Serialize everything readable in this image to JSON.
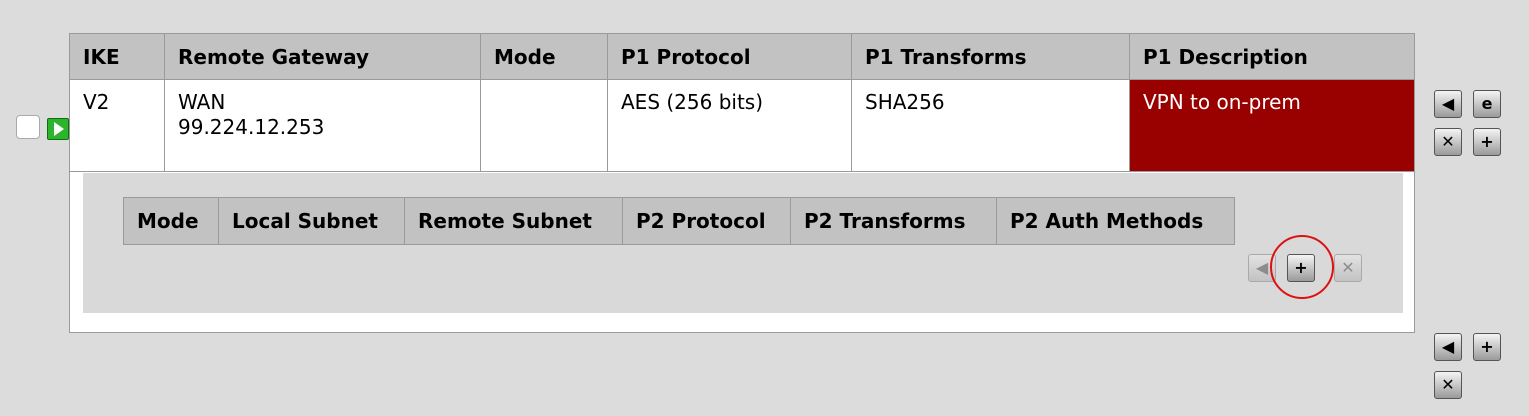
{
  "phase1": {
    "headers": [
      "IKE",
      "Remote Gateway",
      "Mode",
      "P1 Protocol",
      "P1 Transforms",
      "P1 Description"
    ],
    "row": {
      "ike": "V2",
      "gateway_interface": "WAN",
      "gateway_ip": "99.224.12.253",
      "mode": "",
      "protocol": "AES (256 bits)",
      "transforms": "SHA256",
      "description": "VPN to on-prem"
    },
    "row_actions": {
      "move": "◀",
      "edit": "e",
      "delete": "✕",
      "add": "+"
    }
  },
  "phase2": {
    "headers": [
      "Mode",
      "Local Subnet",
      "Remote Subnet",
      "P2 Protocol",
      "P2 Transforms",
      "P2 Auth Methods"
    ],
    "actions": {
      "move": "◀",
      "add": "+",
      "delete": "✕"
    }
  },
  "footer_actions": {
    "move": "◀",
    "add": "+",
    "delete": "✕"
  },
  "colors": {
    "background": "#dcdcdc",
    "header": "#c2c2c2",
    "description_highlight": "#990000",
    "enabled_indicator": "#2cb52c",
    "annotation_circle": "#dd1111"
  }
}
